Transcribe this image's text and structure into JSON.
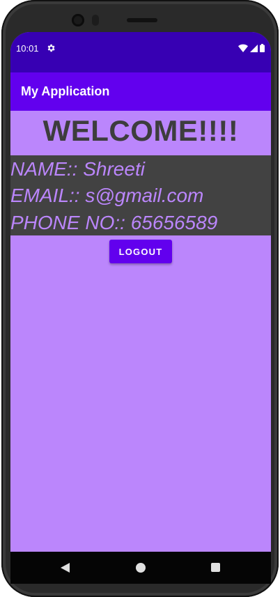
{
  "status_bar": {
    "time": "10:01",
    "icons": [
      "settings-icon",
      "wifi-icon",
      "signal-icon",
      "battery-icon"
    ],
    "color": "#3700b3"
  },
  "app_bar": {
    "title": "My Application",
    "color": "#6200ee"
  },
  "main": {
    "welcome": "WELCOME!!!!",
    "name_line": "NAME::  Shreeti",
    "email_line": "EMAIL::  s@gmail.com",
    "phone_line": "PHONE NO::  65656589",
    "logout_label": "LOGOUT",
    "background_color": "#bb86fc",
    "panel_color": "#424242"
  },
  "nav_bar": {
    "icons": [
      "back-icon",
      "home-icon",
      "recents-icon"
    ]
  }
}
